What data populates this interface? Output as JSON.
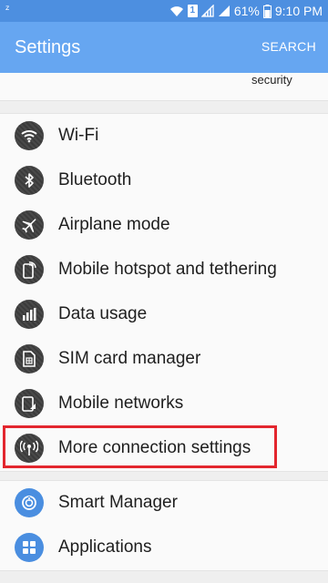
{
  "status_bar": {
    "left_glyph": "ᶻ",
    "battery": "61%",
    "time": "9:10 PM",
    "sim_label": "1"
  },
  "app_bar": {
    "title": "Settings",
    "search": "SEARCH"
  },
  "partial_item": {
    "label": "security"
  },
  "connections": [
    {
      "label": "Wi-Fi",
      "icon": "wifi-icon"
    },
    {
      "label": "Bluetooth",
      "icon": "bluetooth-icon"
    },
    {
      "label": "Airplane mode",
      "icon": "airplane-icon"
    },
    {
      "label": "Mobile hotspot and tethering",
      "icon": "hotspot-icon"
    },
    {
      "label": "Data usage",
      "icon": "data-usage-icon"
    },
    {
      "label": "SIM card manager",
      "icon": "sim-card-icon"
    },
    {
      "label": "Mobile networks",
      "icon": "mobile-networks-icon"
    },
    {
      "label": "More connection settings",
      "icon": "more-connection-icon"
    }
  ],
  "device": [
    {
      "label": "Smart Manager",
      "icon": "smart-manager-icon"
    },
    {
      "label": "Applications",
      "icon": "applications-icon"
    }
  ],
  "colors": {
    "status_bar": "#4d8fe0",
    "app_bar": "#66a6f1",
    "highlight": "#e3262e",
    "icon_dark": "#3b3b3b",
    "icon_blue": "#4a8ee0"
  }
}
